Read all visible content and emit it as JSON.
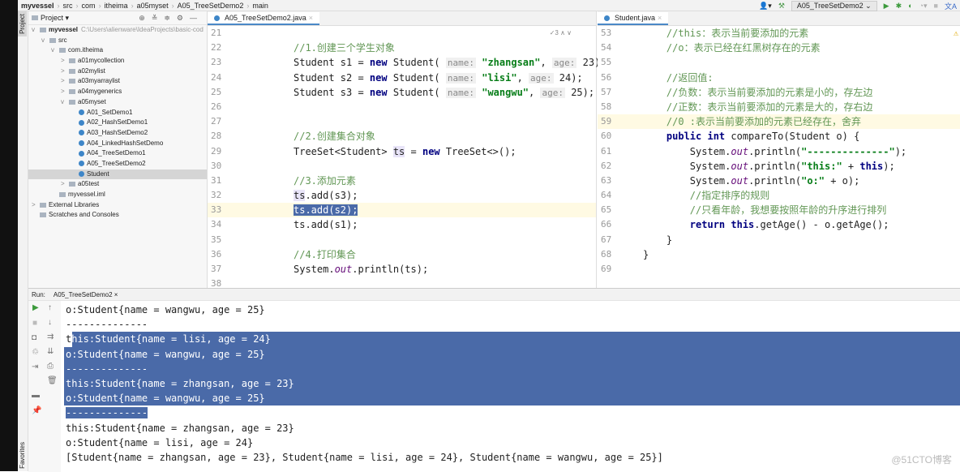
{
  "breadcrumb": [
    "myvessel",
    "src",
    "com",
    "itheima",
    "a05myset",
    "A05_TreeSetDemo2",
    "main"
  ],
  "toolbar": {
    "run_config": "A05_TreeSetDemo2"
  },
  "side_strip": {
    "project": "Project",
    "favorites": "Favorites"
  },
  "project": {
    "title": "Project",
    "items": [
      {
        "label": "myvessel",
        "path": "C:\\Users\\alienware\\IdeaProjects\\basic-cod",
        "indent": 0,
        "fold": "v",
        "type": "module"
      },
      {
        "label": "src",
        "indent": 1,
        "fold": "v",
        "type": "folder"
      },
      {
        "label": "com.itheima",
        "indent": 2,
        "fold": "v",
        "type": "folder"
      },
      {
        "label": "a01mycollection",
        "indent": 3,
        "fold": ">",
        "type": "folder"
      },
      {
        "label": "a02mylist",
        "indent": 3,
        "fold": ">",
        "type": "folder"
      },
      {
        "label": "a03myarraylist",
        "indent": 3,
        "fold": ">",
        "type": "folder"
      },
      {
        "label": "a04mygenerics",
        "indent": 3,
        "fold": ">",
        "type": "folder"
      },
      {
        "label": "a05myset",
        "indent": 3,
        "fold": "v",
        "type": "folder"
      },
      {
        "label": "A01_SetDemo1",
        "indent": 4,
        "type": "class"
      },
      {
        "label": "A02_HashSetDemo1",
        "indent": 4,
        "type": "class"
      },
      {
        "label": "A03_HashSetDemo2",
        "indent": 4,
        "type": "class"
      },
      {
        "label": "A04_LinkedHashSetDemo",
        "indent": 4,
        "type": "class"
      },
      {
        "label": "A04_TreeSetDemo1",
        "indent": 4,
        "type": "class"
      },
      {
        "label": "A05_TreeSetDemo2",
        "indent": 4,
        "type": "class"
      },
      {
        "label": "Student",
        "indent": 4,
        "type": "class",
        "selected": true
      },
      {
        "label": "a05test",
        "indent": 3,
        "fold": ">",
        "type": "folder"
      },
      {
        "label": "myvessel.iml",
        "indent": 2,
        "type": "file"
      },
      {
        "label": "External Libraries",
        "indent": 0,
        "fold": ">",
        "type": "lib"
      },
      {
        "label": "Scratches and Consoles",
        "indent": 0,
        "type": "lib"
      }
    ]
  },
  "editor_left": {
    "tab": "A05_TreeSetDemo2.java",
    "inspection_count": "3",
    "lines": [
      {
        "n": "21",
        "html": ""
      },
      {
        "n": "22",
        "html": "<span class=\"cm\">//1.创建三个学生对象</span>"
      },
      {
        "n": "23",
        "html": "Student s1 = <span class=\"kw\">new</span> Student( <span class=\"hint\">name:</span> <span class=\"st\">\"zhangsan\"</span>, <span class=\"hint\">age:</span> 23);"
      },
      {
        "n": "24",
        "html": "Student s2 = <span class=\"kw\">new</span> Student( <span class=\"hint\">name:</span> <span class=\"st\">\"lisi\"</span>, <span class=\"hint\">age:</span> 24);"
      },
      {
        "n": "25",
        "html": "Student s3 = <span class=\"kw\">new</span> Student( <span class=\"hint\">name:</span> <span class=\"st\">\"wangwu\"</span>, <span class=\"hint\">age:</span> 25);"
      },
      {
        "n": "26",
        "html": ""
      },
      {
        "n": "27",
        "html": ""
      },
      {
        "n": "28",
        "html": "<span class=\"cm\">//2.创建集合对象</span>"
      },
      {
        "n": "29",
        "html": "TreeSet&lt;Student&gt; <span class=\"fld\">ts</span> = <span class=\"kw\">new</span> TreeSet&lt;&gt;();"
      },
      {
        "n": "30",
        "html": ""
      },
      {
        "n": "31",
        "html": "<span class=\"cm\">//3.添加元素</span>"
      },
      {
        "n": "32",
        "html": "<span class=\"fld\">ts</span>.add(s3);"
      },
      {
        "n": "33",
        "html": "<span class=\"selc\">ts.add(s2);</span>"
      },
      {
        "n": "34",
        "html": "ts.add(s1);"
      },
      {
        "n": "35",
        "html": ""
      },
      {
        "n": "36",
        "html": "<span class=\"cm\">//4.打印集合</span>"
      },
      {
        "n": "37",
        "html": "System.<span class=\"it\">out</span>.println(ts);"
      },
      {
        "n": "38",
        "html": ""
      }
    ]
  },
  "editor_right": {
    "tab": "Student.java",
    "lines": [
      {
        "n": "53",
        "html": "    <span class=\"cm\">//this：表示当前要添加的元素</span>"
      },
      {
        "n": "54",
        "html": "    <span class=\"cm\">//o：表示已经在红黑树存在的元素</span>"
      },
      {
        "n": "55",
        "html": ""
      },
      {
        "n": "56",
        "html": "    <span class=\"cm\">//返回值:</span>"
      },
      {
        "n": "57",
        "html": "    <span class=\"cm\">//负数：表示当前要添加的元素是小的，存左边</span>"
      },
      {
        "n": "58",
        "html": "    <span class=\"cm\">//正数：表示当前要添加的元素是大的，存右边</span>"
      },
      {
        "n": "59",
        "html": "    <span class=\"cm\">//0 :表示当前要添加的元素已经存在，舍弃</span>"
      },
      {
        "n": "60",
        "html": "    <span class=\"kw\">public int</span> compareTo(Student o) {"
      },
      {
        "n": "61",
        "html": "        System.<span class=\"it\">out</span>.println(<span class=\"st\">\"--------------\"</span>);"
      },
      {
        "n": "62",
        "html": "        System.<span class=\"it\">out</span>.println(<span class=\"st\">\"this:\"</span> + <span class=\"kw\">this</span>);"
      },
      {
        "n": "63",
        "html": "        System.<span class=\"it\">out</span>.println(<span class=\"st\">\"o:\"</span> + o);"
      },
      {
        "n": "64",
        "html": "        <span class=\"cm\">//指定排序的规则</span>"
      },
      {
        "n": "65",
        "html": "        <span class=\"cm\">//只看年龄，我想要按照年龄的升序进行排列</span>"
      },
      {
        "n": "66",
        "html": "        <span class=\"kw\">return this</span>.getAge() - o.getAge();"
      },
      {
        "n": "67",
        "html": "    }"
      },
      {
        "n": "68",
        "html": "}"
      },
      {
        "n": "69",
        "html": ""
      }
    ]
  },
  "run": {
    "label": "Run:",
    "tab": "A05_TreeSetDemo2",
    "output": [
      {
        "text": "o:Student{name = wangwu, age = 25}",
        "sel": "none"
      },
      {
        "text": "--------------",
        "sel": "none"
      },
      {
        "text": "this:Student{name = lisi, age = 24}",
        "sel": "from1"
      },
      {
        "text": "o:Student{name = wangwu, age = 25}",
        "sel": "full"
      },
      {
        "text": "--------------",
        "sel": "full"
      },
      {
        "text": "this:Student{name = zhangsan, age = 23}",
        "sel": "full"
      },
      {
        "text": "o:Student{name = wangwu, age = 25}",
        "sel": "full"
      },
      {
        "text": "--------------",
        "sel": "text"
      },
      {
        "text": "this:Student{name = zhangsan, age = 23}",
        "sel": "none"
      },
      {
        "text": "o:Student{name = lisi, age = 24}",
        "sel": "none"
      },
      {
        "text": "[Student{name = zhangsan, age = 23}, Student{name = lisi, age = 24}, Student{name = wangwu, age = 25}]",
        "sel": "none"
      }
    ]
  },
  "watermark": "@51CTO博客",
  "colors": {
    "selection": "#4a6aa8",
    "comment": "#629755",
    "keyword": "#000080",
    "string": "#067d17"
  }
}
